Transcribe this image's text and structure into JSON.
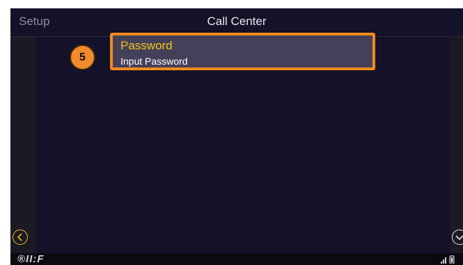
{
  "header": {
    "back_label": "Setup",
    "title": "Call Center"
  },
  "list": {
    "items": [
      {
        "title": "Password",
        "subtitle": "Input Password"
      }
    ]
  },
  "step_badge": "5",
  "footer": {
    "logo_text": "®II:F"
  },
  "colors": {
    "background": "#141228",
    "highlight_border": "#f28a1e",
    "item_title": "#f3c318",
    "badge": "#f2892b"
  },
  "icons": {
    "left_nav": "chevron-left-circle-icon",
    "right_nav": "chevron-down-circle-icon",
    "signal": "signal-icon",
    "battery": "battery-icon"
  }
}
